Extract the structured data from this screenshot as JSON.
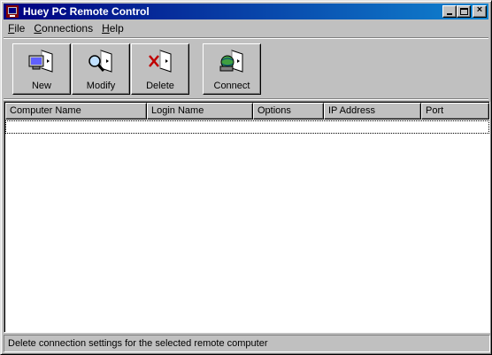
{
  "window": {
    "title": "Huey PC Remote Control"
  },
  "menu": [
    {
      "label": "File",
      "accel": "F",
      "rest": "ile"
    },
    {
      "label": "Connections",
      "accel": "C",
      "rest": "onnections"
    },
    {
      "label": "Help",
      "accel": "H",
      "rest": "elp"
    }
  ],
  "toolbar": {
    "new_label": "New",
    "modify_label": "Modify",
    "delete_label": "Delete",
    "connect_label": "Connect"
  },
  "list": {
    "columns": [
      "Computer Name",
      "Login Name",
      "Options",
      "IP Address",
      "Port"
    ],
    "rows": []
  },
  "status": {
    "text": "Delete connection settings for the selected remote computer"
  },
  "colors": {
    "titlebar_start": "#000080",
    "titlebar_end": "#1084d0",
    "face": "#c0c0c0"
  }
}
